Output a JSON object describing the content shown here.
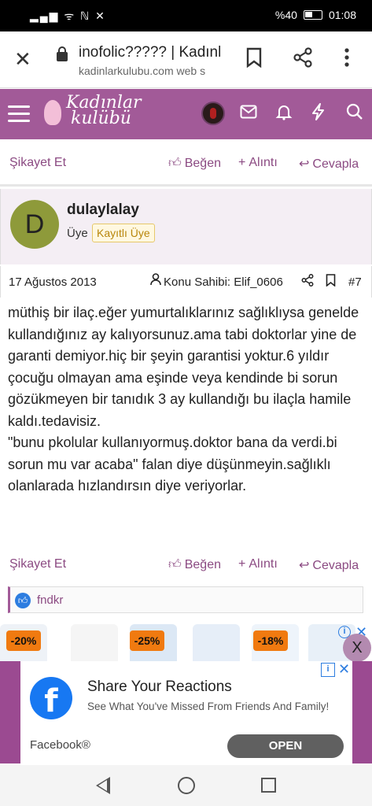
{
  "status_bar": {
    "signal": "▂▄▆ ᯤ ℕ ✕",
    "battery_pct": "%40",
    "time": "01:08"
  },
  "browser": {
    "page_title": "inofolic????? | Kadınlar",
    "domain": "kadinlarkulubu.com web s",
    "close_icon": "close-icon",
    "bookmark_icon": "bookmark-icon",
    "share_icon": "share-icon",
    "menu_icon": "more-vert-icon"
  },
  "site_header": {
    "logo_line1": "Kadınlar",
    "logo_line2": "kulübü",
    "icons": [
      "menu-icon",
      "mail-icon",
      "bell-icon",
      "bolt-icon",
      "search-icon"
    ]
  },
  "prev_post_actions": {
    "report": "Şikayet Et",
    "like": "Beğen",
    "quote": "Alıntı",
    "reply": "Cevapla"
  },
  "post": {
    "avatar_letter": "D",
    "username": "dulaylalay",
    "role": "Üye",
    "badge": "Kayıtlı Üye",
    "date": "17 Ağustos 2013",
    "author_label": "Konu Sahibi: Elif_0606",
    "number": "#7",
    "body": [
      "müthiş bir ilaç.eğer yumurtalıklarınız sağlıklıysa genelde kullandığınız ay kalıyorsunuz.ama tabi doktorlar yine de garanti demiyor.hiç bir şeyin garantisi yoktur.6 yıldır çocuğu olmayan ama eşinde veya kendinde bi sorun gözükmeyen bir tanıdık 3 ay kullandığı bu ilaçla hamile kaldı.tedavisiz.",
      "\"bunu pkolular kullanıyormuş.doktor bana da verdi.bi sorun mu var acaba\" falan diye düşünmeyin.sağlıklı olanlarada hızlandırsın diye veriyorlar."
    ],
    "actions": {
      "report": "Şikayet Et",
      "like": "Beğen",
      "quote": "Alıntı",
      "reply": "Cevapla"
    },
    "liked_by": "fndkr"
  },
  "ad_strip": {
    "discounts": [
      "-20%",
      "-25%",
      "-18%"
    ],
    "close_label": "X"
  },
  "fb_ad": {
    "title": "Share Your Reactions",
    "description": "See What You've Missed From Friends And Family!",
    "brand": "Facebook®",
    "cta": "OPEN",
    "logo_letter": "f"
  },
  "nav": {
    "icons": [
      "back-icon",
      "home-icon",
      "recents-icon"
    ]
  }
}
